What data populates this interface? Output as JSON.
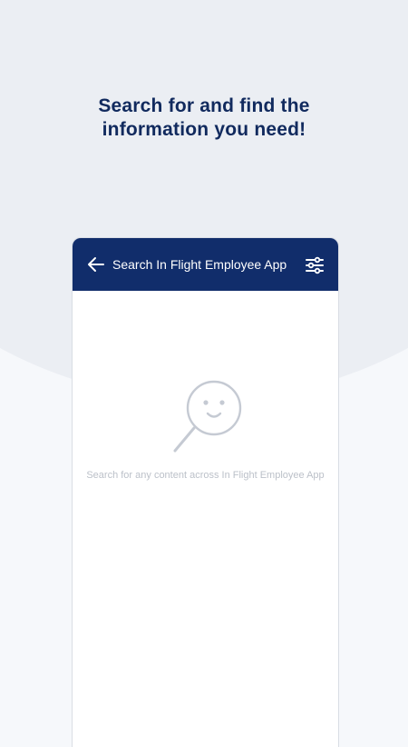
{
  "promo": {
    "headline_line1": "Search for and find the",
    "headline_line2": "information you need!"
  },
  "app_bar": {
    "title": "Search In Flight Employee App",
    "back_icon": "arrow-left-icon",
    "filter_icon": "sliders-icon"
  },
  "empty_state": {
    "illustration_icon": "smiling-magnifier-icon",
    "message": "Search for any content across In Flight Employee App"
  },
  "colors": {
    "app_bar_background": "#112d6b",
    "headline": "#112a5e",
    "empty_text": "#bcc1c9",
    "illustration_stroke": "#c5cad3"
  }
}
